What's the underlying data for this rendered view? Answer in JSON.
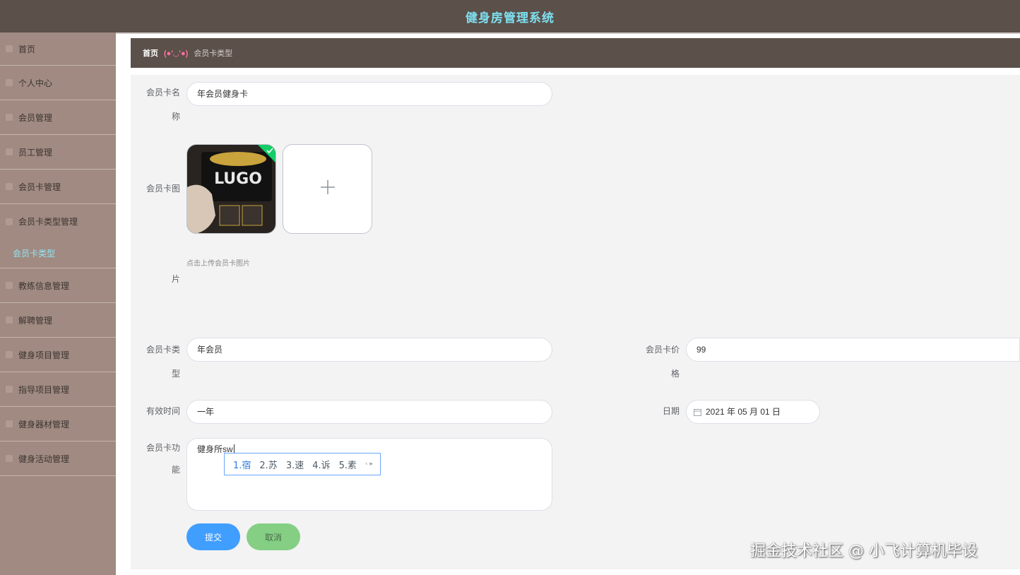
{
  "app": {
    "title": "健身房管理系统"
  },
  "sidebar": {
    "items": [
      {
        "label": "首页"
      },
      {
        "label": "个人中心"
      },
      {
        "label": "会员管理"
      },
      {
        "label": "员工管理"
      },
      {
        "label": "会员卡管理"
      },
      {
        "label": "会员卡类型管理"
      },
      {
        "label": "会员卡类型",
        "active": true
      },
      {
        "label": "教练信息管理"
      },
      {
        "label": "解聘管理"
      },
      {
        "label": "健身项目管理"
      },
      {
        "label": "指导项目管理"
      },
      {
        "label": "健身器材管理"
      },
      {
        "label": "健身活动管理"
      }
    ]
  },
  "breadcrumb": {
    "home": "首页",
    "separator": "(●'◡'●)",
    "current": "会员卡类型"
  },
  "form": {
    "card_name": {
      "label_1": "会员卡名",
      "label_2": "称",
      "value": "年会员健身卡"
    },
    "card_image": {
      "label_1": "会员卡图",
      "label_2": "片",
      "tip": "点击上传会员卡图片",
      "thumb_text": "LUGO"
    },
    "card_type": {
      "label_1": "会员卡类",
      "label_2": "型",
      "value": "年会员"
    },
    "card_price": {
      "label_1": "会员卡价",
      "label_2": "格",
      "value": "99"
    },
    "valid_time": {
      "label": "有效时间",
      "value": "一年"
    },
    "date": {
      "label": "日期",
      "value": "2021 年 05 月 01 日"
    },
    "card_function": {
      "label_1": "会员卡功",
      "label_2": "能",
      "value": "健身所sw"
    },
    "submit_label": "提交",
    "cancel_label": "取消"
  },
  "ime": {
    "candidates": [
      "1.宿",
      "2.苏",
      "3.速",
      "4.诉",
      "5.素"
    ]
  },
  "watermark": "掘金技术社区 @ 小飞计算机毕设",
  "colors": {
    "header": "#5b504a",
    "title": "#7ee0f0",
    "sidebar": "#a08a81",
    "submit": "#409eff",
    "cancel": "#85cf85"
  }
}
